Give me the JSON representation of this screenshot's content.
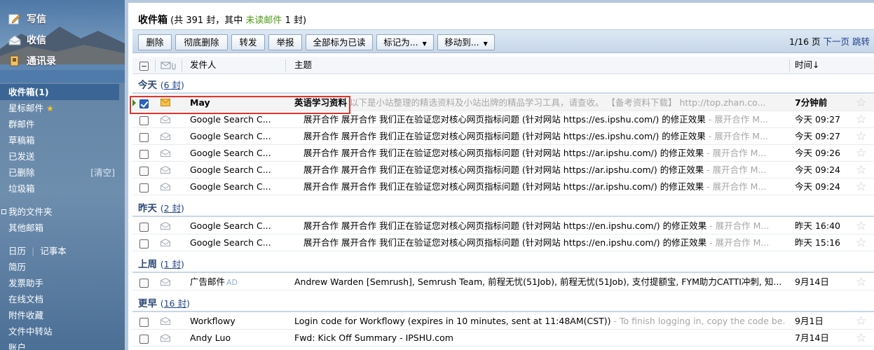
{
  "sidebar": {
    "actions": [
      {
        "icon": "compose-pencil-icon",
        "label": "写信"
      },
      {
        "icon": "receive-mail-icon",
        "label": "收信"
      },
      {
        "icon": "contacts-book-icon",
        "label": "通讯录"
      }
    ],
    "folders": [
      {
        "label": "收件箱(1)",
        "active": true
      },
      {
        "label": "星标邮件",
        "star": true
      },
      {
        "label": "群邮件"
      },
      {
        "label": "草稿箱"
      },
      {
        "label": "已发送"
      },
      {
        "label": "已删除",
        "extra": "[清空]"
      },
      {
        "label": "垃圾箱"
      }
    ],
    "my_folders": "我的文件夹",
    "other_mailbox": "其他邮箱",
    "tools": {
      "calendar": "日历",
      "notes": "记事本",
      "resume": "简历",
      "invoice": "发票助手",
      "docs": "在线文档",
      "attachments": "附件收藏",
      "transfer": "文件中转站",
      "more": "账户"
    }
  },
  "main": {
    "title": {
      "prefix": "收件箱",
      "mid": " (共 391 封，其中 ",
      "unread_link": "未读邮件",
      "suffix": " 1 封)"
    },
    "toolbar": {
      "delete": "删除",
      "perm_delete": "彻底删除",
      "forward": "转发",
      "report": "举报",
      "mark_all_read": "全部标为已读",
      "mark_as": "标记为...",
      "move_to": "移动到..."
    },
    "pager": {
      "current": "1/16",
      "unit": " 页 ",
      "next": "下一页",
      "jump": "跳转"
    },
    "columns": {
      "sender": "发件人",
      "subject": "主题",
      "time": "时间↓"
    },
    "groups": [
      {
        "label": "今天",
        "count": "6 封"
      },
      {
        "label": "昨天",
        "count": "2 封"
      },
      {
        "label": "上周",
        "count": "1 封"
      },
      {
        "label": "更早",
        "count": "16 封"
      }
    ],
    "emails": [
      {
        "sender": "May",
        "subject": "英语学习资料",
        "preview": " 以下是小站整理的精选资料及小站出牌的精品学习工具，请查收。 【备考资料下载】 http://top.zhan.co...",
        "time": "7分钟前",
        "unread": true,
        "checked": true
      },
      {
        "sender": "Google Search C...",
        "subject": "展开合作 展开合作 我们正在验证您对核心网页指标问题 (针对网站 https://es.ipshu.com/) 的修正效果",
        "preview": " - 展开合作  M...",
        "time": "今天 09:27"
      },
      {
        "sender": "Google Search C...",
        "subject": "展开合作 展开合作 我们正在验证您对核心网页指标问题 (针对网站 https://es.ipshu.com/) 的修正效果",
        "preview": " - 展开合作  M...",
        "time": "今天 09:27"
      },
      {
        "sender": "Google Search C...",
        "subject": "展开合作 展开合作 我们正在验证您对核心网页指标问题 (针对网站 https://ar.ipshu.com/) 的修正效果",
        "preview": " - 展开合作  M...",
        "time": "今天 09:26"
      },
      {
        "sender": "Google Search C...",
        "subject": "展开合作 展开合作 我们正在验证您对核心网页指标问题 (针对网站 https://ar.ipshu.com/) 的修正效果",
        "preview": " - 展开合作  M...",
        "time": "今天 09:24"
      },
      {
        "sender": "Google Search C...",
        "subject": "展开合作 展开合作 我们正在验证您对核心网页指标问题 (针对网站 https://ar.ipshu.com/) 的修正效果",
        "preview": " - 展开合作  M...",
        "time": "今天 09:24"
      },
      {
        "sender": "Google Search C...",
        "subject": "展开合作 展开合作 我们正在验证您对核心网页指标问题 (针对网站 https://en.ipshu.com/) 的修正效果",
        "preview": " - 展开合作  M...",
        "time": "昨天 16:40"
      },
      {
        "sender": "Google Search C...",
        "subject": "展开合作 展开合作 我们正在验证您对核心网页指标问题 (针对网站 https://en.ipshu.com/) 的修正效果",
        "preview": " - 展开合作  M...",
        "time": "昨天 15:16"
      },
      {
        "sender": "广告邮件",
        "ad": "AD",
        "subject": "Andrew Warden [Semrush], Semrush Team, 前程无忧(51Job), 前程无忧(51Job), 支付提额宝, FYM助力CATTI冲刺, 知...",
        "preview": "",
        "time": "9月14日"
      },
      {
        "sender": "Workflowy",
        "subject": "Login code for Workflowy (expires in 10 minutes, sent at 11:48AM(CST))",
        "preview": " - To finish logging in, copy the code be...",
        "time": "9月1日"
      },
      {
        "sender": "Andy Luo",
        "subject": "Fwd: Kick Off Summary - IPSHU.com",
        "preview": "",
        "time": "7月14日"
      }
    ]
  }
}
